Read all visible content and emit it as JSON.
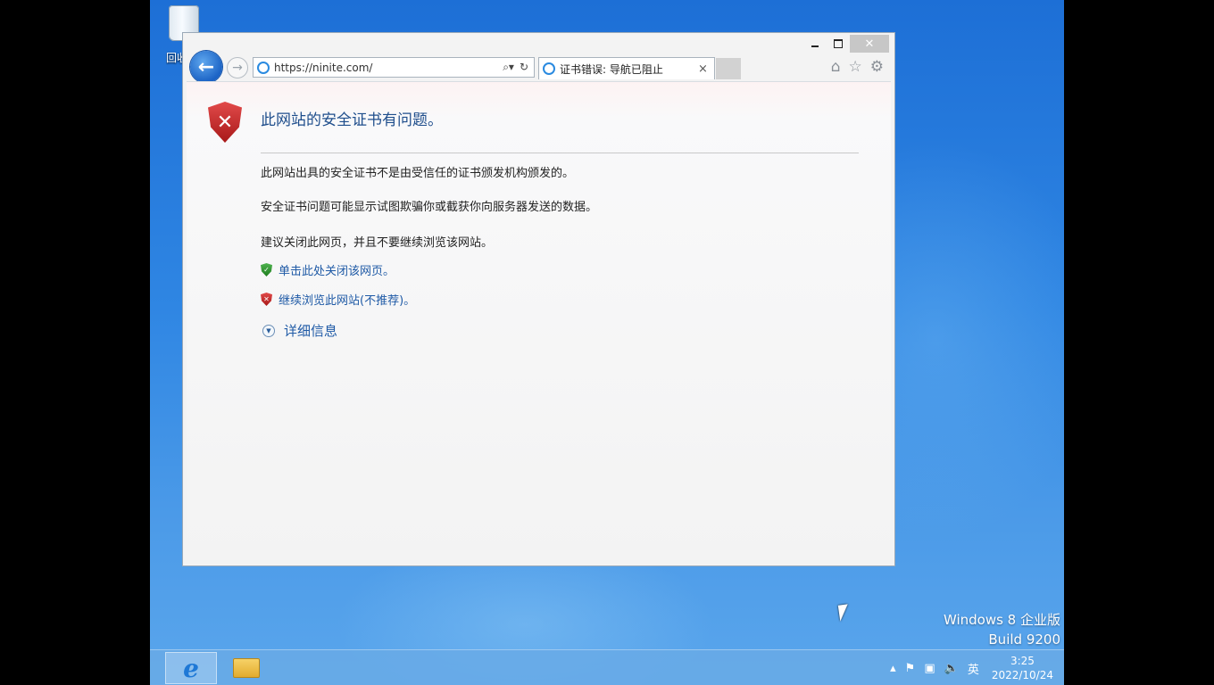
{
  "desktop": {
    "recycle_bin_label": "回收站"
  },
  "browser": {
    "address_url": "https://ninite.com/",
    "tab_title": "证书错误: 导航已阻止",
    "tab_close": "×",
    "window_close": "✕",
    "back_glyph": "←",
    "forward_glyph": "→",
    "search_glyph": "⌕▾",
    "refresh_glyph": "↻",
    "home_glyph": "⌂",
    "favorites_glyph": "☆",
    "settings_glyph": "⚙"
  },
  "page": {
    "heading": "此网站的安全证书有问题。",
    "para1": "此网站出具的安全证书不是由受信任的证书颁发机构颁发的。",
    "para2": "安全证书问题可能显示试图欺骗你或截获你向服务器发送的数据。",
    "para3": "建议关闭此网页，并且不要继续浏览该网站。",
    "link_close": "单击此处关闭该网页。",
    "link_continue": "继续浏览此网站(不推荐)。",
    "more_info": "详细信息"
  },
  "os": {
    "edition": "Windows 8 企业版",
    "build": "Build 9200",
    "ime": "英",
    "time": "3:25",
    "date": "2022/10/24"
  },
  "colors": {
    "desktop": "#2f86e3",
    "link": "#1f5aa6",
    "heading": "#1f4e8c",
    "error_red": "#c42525",
    "ok_green": "#2f8f2f"
  }
}
